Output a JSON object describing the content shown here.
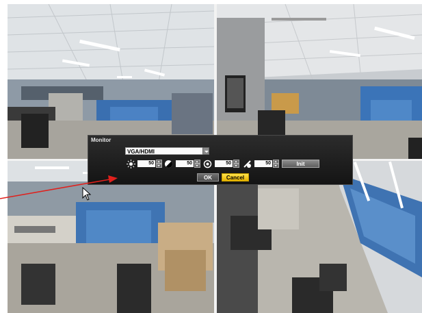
{
  "dialog": {
    "title": "Monitor",
    "output_select": "VGA/HDMI",
    "controls": [
      {
        "icon": "brightness-icon",
        "value": "50"
      },
      {
        "icon": "contrast-icon",
        "value": "50"
      },
      {
        "icon": "saturation-icon",
        "value": "50"
      },
      {
        "icon": "hue-icon",
        "value": "50"
      }
    ],
    "init_label": "Init",
    "ok_label": "OK",
    "cancel_label": "Cancel"
  },
  "colors": {
    "annotation_arrow": "#e0201c",
    "cancel_accent": "#f2c800"
  }
}
